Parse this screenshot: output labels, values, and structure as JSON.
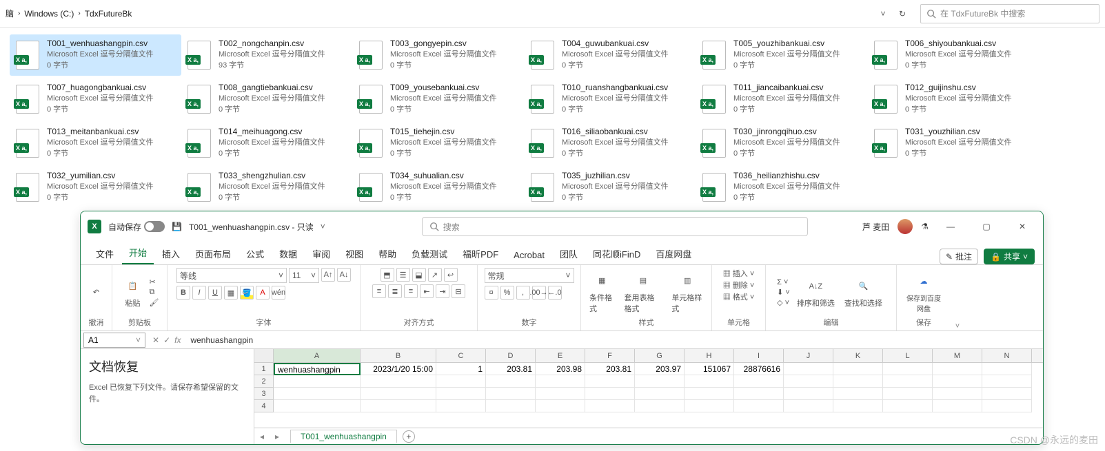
{
  "explorer": {
    "breadcrumb": [
      "脑",
      "Windows (C:)",
      "TdxFutureBk"
    ],
    "search_placeholder": "在 TdxFutureBk 中搜索",
    "file_type": "Microsoft Excel 逗号分隔值文件",
    "files": [
      {
        "name": "T001_wenhuashangpin.csv",
        "size": "0 字节",
        "selected": true
      },
      {
        "name": "T002_nongchanpin.csv",
        "size": "93 字节"
      },
      {
        "name": "T003_gongyepin.csv",
        "size": "0 字节"
      },
      {
        "name": "T004_guwubankuai.csv",
        "size": "0 字节"
      },
      {
        "name": "T005_youzhibankuai.csv",
        "size": "0 字节"
      },
      {
        "name": "T006_shiyoubankuai.csv",
        "size": "0 字节"
      },
      {
        "name": "T007_huagongbankuai.csv",
        "size": "0 字节"
      },
      {
        "name": "T008_gangtiebankuai.csv",
        "size": "0 字节"
      },
      {
        "name": "T009_yousebankuai.csv",
        "size": "0 字节"
      },
      {
        "name": "T010_ruanshangbankuai.csv",
        "size": "0 字节"
      },
      {
        "name": "T011_jiancaibankuai.csv",
        "size": "0 字节"
      },
      {
        "name": "T012_guijinshu.csv",
        "size": "0 字节"
      },
      {
        "name": "T013_meitanbankuai.csv",
        "size": "0 字节"
      },
      {
        "name": "T014_meihuagong.csv",
        "size": "0 字节"
      },
      {
        "name": "T015_tiehejin.csv",
        "size": "0 字节"
      },
      {
        "name": "T016_siliaobankuai.csv",
        "size": "0 字节"
      },
      {
        "name": "T030_jinrongqihuo.csv",
        "size": "0 字节"
      },
      {
        "name": "T031_youzhilian.csv",
        "size": "0 字节"
      },
      {
        "name": "T032_yumilian.csv",
        "size": "0 字节"
      },
      {
        "name": "T033_shengzhulian.csv",
        "size": "0 字节"
      },
      {
        "name": "T034_suhualian.csv",
        "size": "0 字节"
      },
      {
        "name": "T035_juzhilian.csv",
        "size": "0 字节"
      },
      {
        "name": "T036_heilianzhishu.csv",
        "size": "0 字节"
      }
    ]
  },
  "excel": {
    "autosave_label": "自动保存",
    "title": "T001_wenhuashangpin.csv - 只读",
    "search_placeholder": "搜索",
    "user": "芦 麦田",
    "tabs": [
      "文件",
      "开始",
      "插入",
      "页面布局",
      "公式",
      "数据",
      "审阅",
      "视图",
      "帮助",
      "负载测试",
      "福昕PDF",
      "Acrobat",
      "团队",
      "同花顺iFinD",
      "百度网盘"
    ],
    "active_tab": "开始",
    "comment_btn": "批注",
    "share_btn": "共享",
    "ribbon": {
      "undo": "撤消",
      "clipboard": "剪贴板",
      "paste": "粘贴",
      "font": "字体",
      "font_name": "等线",
      "font_size": "11",
      "align": "对齐方式",
      "number": "数字",
      "number_format": "常规",
      "styles": "样式",
      "cond": "条件格式",
      "tablefmt": "套用表格格式",
      "cellstyle": "单元格样式",
      "cells": "单元格",
      "insert": "插入",
      "delete": "删除",
      "format": "格式",
      "editing": "编辑",
      "sort": "排序和筛选",
      "find": "查找和选择",
      "save": "保存",
      "baidu": "保存到百度网盘"
    },
    "namebox": "A1",
    "formula": "wenhuashangpin",
    "recovery": {
      "title": "文档恢复",
      "text": "Excel 已恢复下列文件。请保存希望保留的文件。"
    },
    "columns": [
      "A",
      "B",
      "C",
      "D",
      "E",
      "F",
      "G",
      "H",
      "I",
      "J",
      "K",
      "L",
      "M",
      "N"
    ],
    "rows": [
      "1",
      "2",
      "3",
      "4"
    ],
    "data_row": [
      "wenhuashangpin",
      "2023/1/20 15:00",
      "1",
      "203.81",
      "203.98",
      "203.81",
      "203.97",
      "151067",
      "28876616"
    ],
    "sheet_tab": "T001_wenhuashangpin"
  },
  "watermark": "CSDN @永远的麦田"
}
